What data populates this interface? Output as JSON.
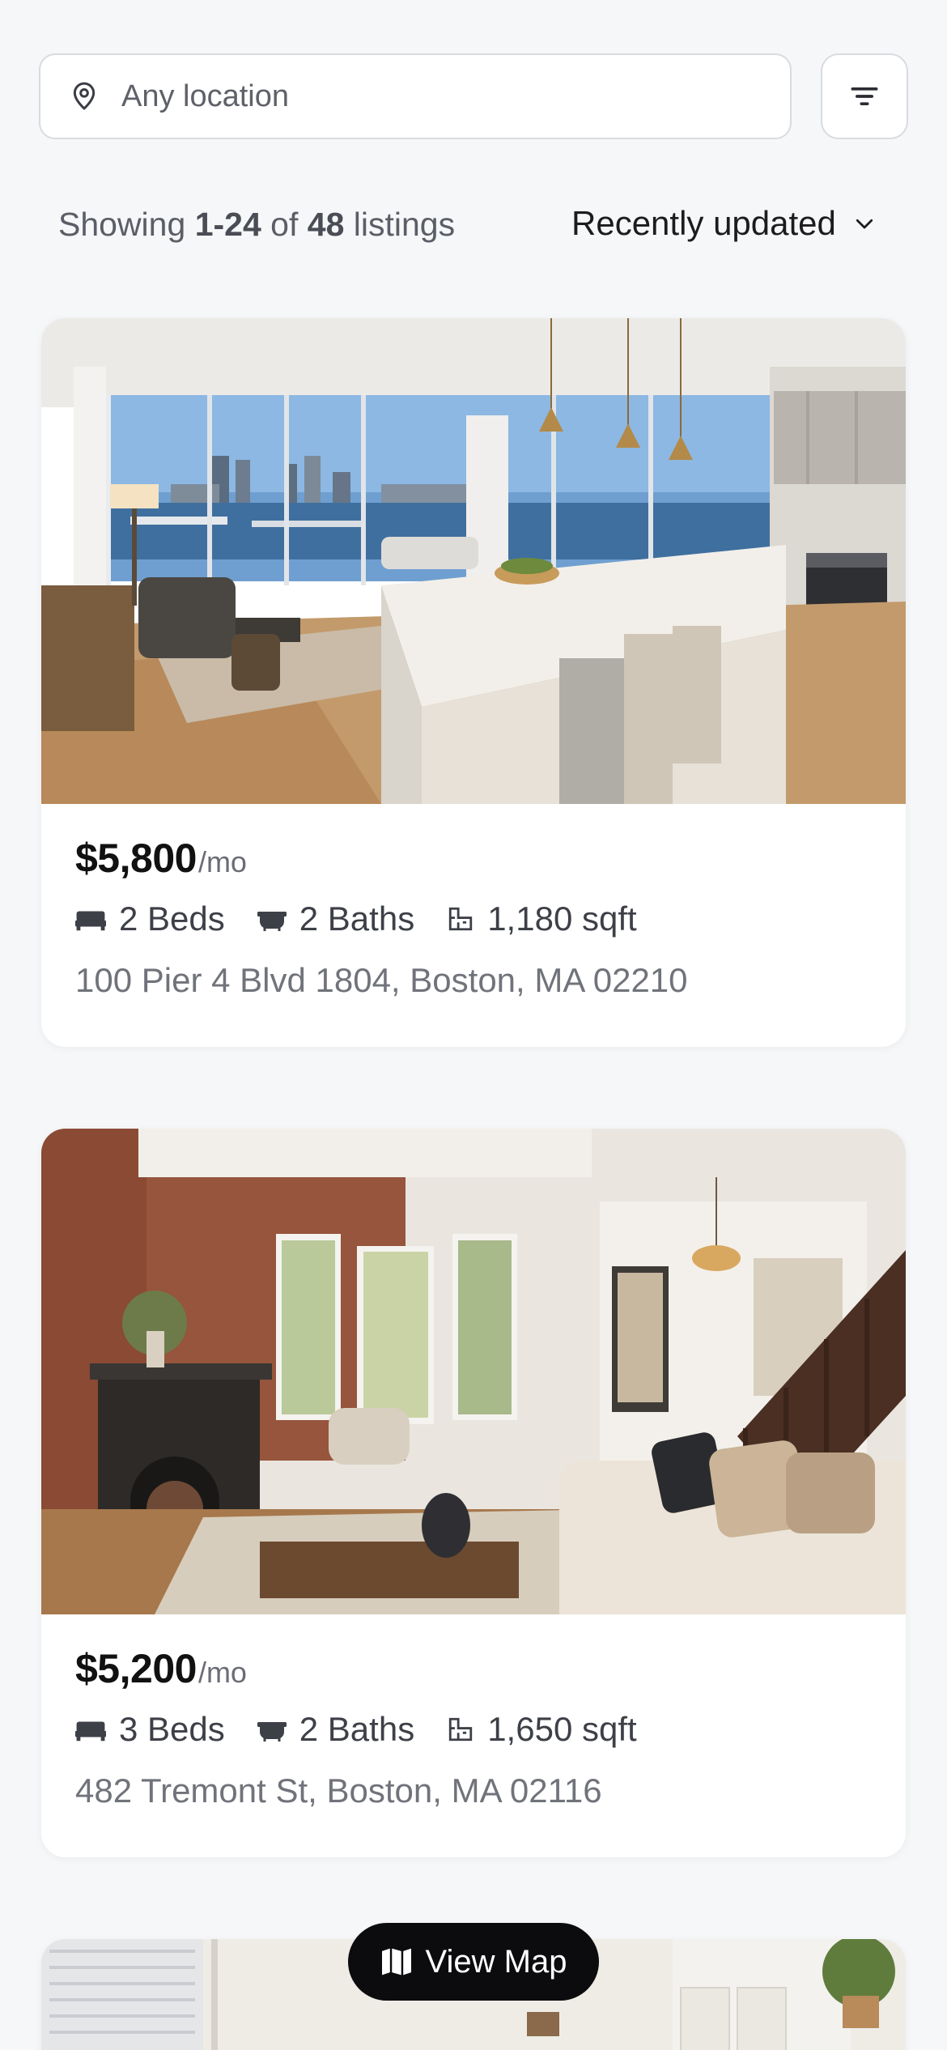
{
  "search": {
    "placeholder": "Any location",
    "icon": "location-pin-icon"
  },
  "filter": {
    "icon": "filter-lines-icon"
  },
  "results": {
    "prefix": "Showing",
    "range": "1-24",
    "of": "of",
    "total": "48",
    "suffix": "listings"
  },
  "sort": {
    "label": "Recently updated",
    "icon": "chevron-down-icon"
  },
  "listings": [
    {
      "price": "$5,800",
      "per": "/mo",
      "beds": "2 Beds",
      "baths": "2 Baths",
      "sqft": "1,180 sqft",
      "address": "100 Pier 4 Blvd 1804, Boston, MA 02210",
      "photo": "modern-waterfront-kitchen-living-room"
    },
    {
      "price": "$5,200",
      "per": "/mo",
      "beds": "3 Beds",
      "baths": "2 Baths",
      "sqft": "1,650 sqft",
      "address": "482 Tremont St, Boston, MA 02116",
      "photo": "brownstone-living-room-bay-windows"
    },
    {
      "photo": "bright-kitchen-with-plants"
    }
  ],
  "map_button": {
    "label": "View Map",
    "icon": "map-icon"
  },
  "colors": {
    "background": "#f6f7f9",
    "card": "#ffffff",
    "map_button": "#0c0c0e",
    "price_text": "#111111",
    "muted_text": "#70737a"
  }
}
